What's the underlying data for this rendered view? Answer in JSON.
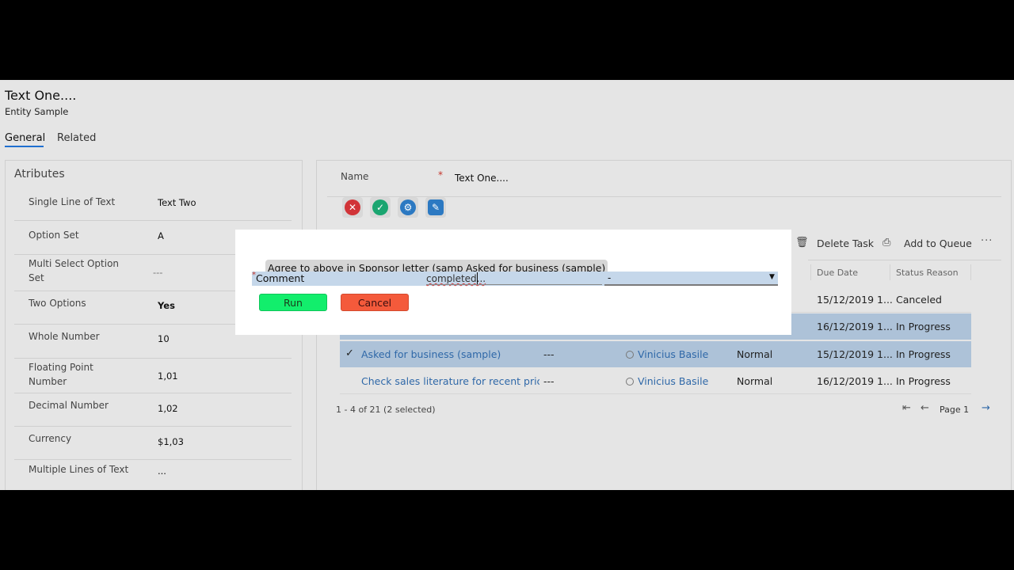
{
  "header": {
    "title": "Text One....",
    "subtitle": "Entity Sample",
    "tabs": [
      {
        "label": "General"
      },
      {
        "label": "Related"
      }
    ]
  },
  "attributes": {
    "title": "Atributes",
    "rows": [
      {
        "label": "Single Line of Text",
        "value": "Text Two"
      },
      {
        "label": "Option Set",
        "value": "A"
      },
      {
        "label": "Multi Select Option Set",
        "value": "---"
      },
      {
        "label": "Two Options",
        "value": "Yes"
      },
      {
        "label": "Whole Number",
        "value": "10"
      },
      {
        "label": "Floating Point Number",
        "value": "1,01"
      },
      {
        "label": "Decimal Number",
        "value": "1,02"
      },
      {
        "label": "Currency",
        "value": "$1,03"
      },
      {
        "label": "Multiple Lines of Text",
        "value": "..."
      }
    ]
  },
  "main": {
    "name_label": "Name",
    "required_marker": "*",
    "name_value": "Text One....",
    "action_icons": [
      {
        "name": "cancel-x-icon",
        "glyph": "✕",
        "color": "#d13438"
      },
      {
        "name": "check-icon",
        "glyph": "✓",
        "color": "#1aa570"
      },
      {
        "name": "gear-icon",
        "glyph": "⚙",
        "color": "#2c79c2"
      },
      {
        "name": "edit-icon",
        "glyph": "✎",
        "color": "#2c79c2"
      }
    ],
    "commands": {
      "delete_label": "Delete Task",
      "queue_label": "Add to Queue",
      "more": "···"
    },
    "grid": {
      "columns": [
        "Due Date",
        "Status Reason"
      ],
      "rows": [
        {
          "subject": "",
          "regarding": "",
          "owner": "",
          "priority": "",
          "due": "15/12/2019 1...",
          "status": "Canceled",
          "selected": false,
          "partial": true
        },
        {
          "subject": "",
          "regarding": "",
          "owner": "",
          "priority": "",
          "due": "16/12/2019 1...",
          "status": "In Progress",
          "selected": true,
          "partial": true
        },
        {
          "subject": "Asked for business (sample)",
          "regarding": "---",
          "owner": "Vinicius Basile",
          "priority": "Normal",
          "due": "15/12/2019 1...",
          "status": "In Progress",
          "selected": true,
          "partial": false
        },
        {
          "subject": "Check sales literature for recent price list (s",
          "regarding": "---",
          "owner": "Vinicius Basile",
          "priority": "Normal",
          "due": "16/12/2019 1...",
          "status": "In Progress",
          "selected": false,
          "partial": false
        }
      ],
      "footer_count": "1 - 4 of 21 (2 selected)",
      "page_label": "Page 1"
    }
  },
  "dialog": {
    "chips": [
      "Agree to above in Sponsor letter (sample)",
      "Asked for business (sample)"
    ],
    "comment_marker": "*",
    "comment_label": "Comment",
    "comment_value": "completed...",
    "dropdown_value": "-",
    "run_label": "Run",
    "cancel_label": "Cancel",
    "run_color": "#12ee6c",
    "cancel_color": "#f45a3b"
  }
}
